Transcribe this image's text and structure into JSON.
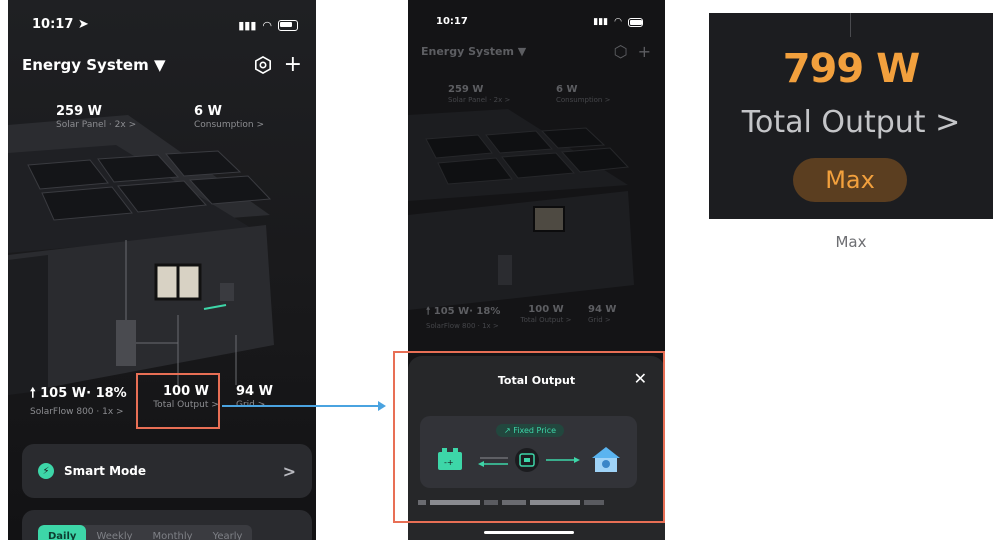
{
  "phone1": {
    "status": {
      "time": "10:17 ➤"
    },
    "header": {
      "title": "Energy System ▼",
      "add_label": "+"
    },
    "metrics": {
      "solar": {
        "value": "259 W",
        "label": "Solar Panel · 2x >"
      },
      "consumption": {
        "value": "6 W",
        "label": "Consumption >"
      },
      "solarflow": {
        "value": "🠕 105 W· 18%",
        "label": "SolarFlow 800 · 1x >"
      },
      "output": {
        "value": "100 W",
        "label": "Total Output >"
      },
      "grid": {
        "value": "94 W",
        "label": "Grid >"
      }
    },
    "smart_mode": {
      "label": "Smart Mode",
      "chevron": ">"
    },
    "tabs": [
      "Daily",
      "Weekly",
      "Monthly",
      "Yearly"
    ]
  },
  "phone2": {
    "status": {
      "time": "10:17"
    },
    "header": {
      "title": "Energy System ▼",
      "add_label": "+"
    },
    "metrics": {
      "solar": {
        "value": "259 W",
        "label": "Solar Panel · 2x >"
      },
      "consumption": {
        "value": "6 W",
        "label": "Consumption >"
      },
      "solarflow": {
        "value": "🠕 105 W· 18%",
        "label": "SolarFlow 800 · 1x >"
      },
      "output": {
        "value": "100 W",
        "label": "Total Output >"
      },
      "grid": {
        "value": "94 W",
        "label": "Grid >"
      }
    },
    "sheet": {
      "title": "Total Output",
      "close_label": "✕",
      "badge": "Fixed Price"
    }
  },
  "zoom": {
    "value": "799 W",
    "label": "Total Output >",
    "pill": "Max",
    "caption": "Max"
  },
  "colors": {
    "accent": "#3dd6a8",
    "highlight": "#e86f55",
    "connector": "#4aa3e0",
    "output_value": "#f2a03d"
  }
}
